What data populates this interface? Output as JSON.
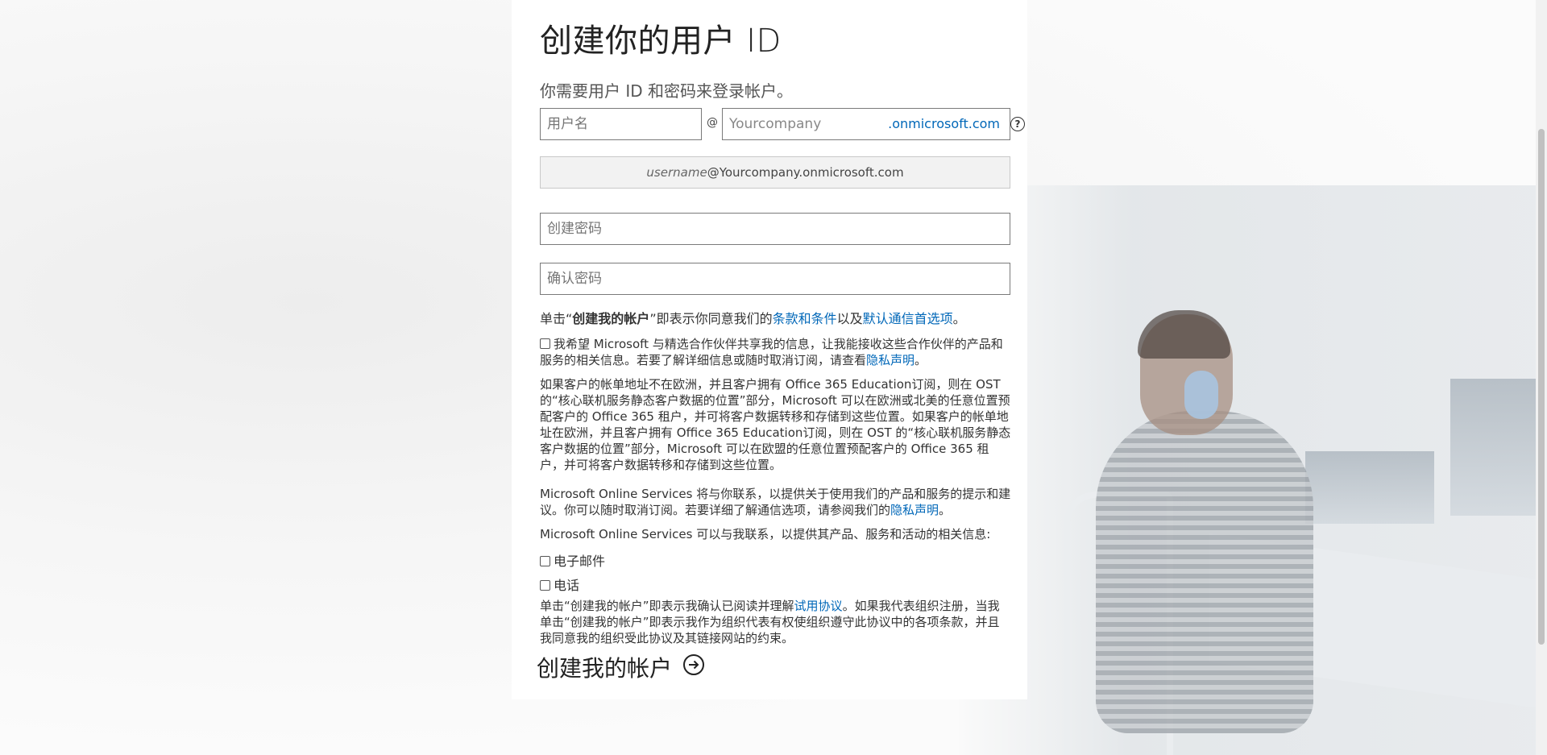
{
  "header": {
    "title": "创建你的用户 ID",
    "subtitle": "你需要用户 ID 和密码来登录帐户。"
  },
  "form": {
    "username_placeholder": "用户名",
    "at_symbol": "@",
    "company_placeholder": "Yourcompany",
    "domain_suffix": ".onmicrosoft.com",
    "help_label": "?",
    "preview_username": "username",
    "preview_domain": "@Yourcompany.onmicrosoft.com",
    "password_placeholder": "创建密码",
    "confirm_password_placeholder": "确认密码"
  },
  "terms": {
    "prefix": "单击“",
    "bold_action": "创建我的帐户",
    "middle": "”即表示你同意我们的",
    "terms_link": "条款和条件",
    "and": "以及",
    "comm_link": "默认通信首选项",
    "end": "。"
  },
  "partner_consent": {
    "text": "我希望 Microsoft 与精选合作伙伴共享我的信息，让我能接收这些合作伙伴的产品和服务的相关信息。若要了解详细信息或随时取消订阅，请查看",
    "privacy_link": "隐私声明",
    "end": "。"
  },
  "data_location": {
    "text": "如果客户的帐单地址不在欧洲，并且客户拥有 Office 365 Education订阅，则在 OST 的“核心联机服务静态客户数据的位置”部分，Microsoft 可以在欧洲或北美的任意位置预配客户的 Office 365 租户，并可将客户数据转移和存储到这些位置。如果客户的帐单地址在欧洲，并且客户拥有 Office 365 Education订阅，则在 OST 的“核心联机服务静态客户数据的位置”部分，Microsoft 可以在欧盟的任意位置预配客户的 Office 365 租户，并可将客户数据转移和存储到这些位置。"
  },
  "contact_notice": {
    "text": "Microsoft Online Services 将与你联系，以提供关于使用我们的产品和服务的提示和建议。你可以随时取消订阅。若要详细了解通信选项，请参阅我们的",
    "privacy_link": "隐私声明",
    "end": "。"
  },
  "contact_options": {
    "intro": "Microsoft Online Services 可以与我联系，以提供其产品、服务和活动的相关信息:",
    "email_label": "电子邮件",
    "phone_label": "电话"
  },
  "trial_agreement": {
    "prefix": "单击“创建我的帐户”即表示我确认已阅读并理解",
    "trial_link": "试用协议",
    "suffix": "。如果我代表组织注册，当我单击“创建我的帐户”即表示我作为组织代表有权使组织遵守此协议中的各项条款，并且我同意我的组织受此协议及其链接网站的约束。"
  },
  "cta": {
    "label": "创建我的帐户"
  }
}
